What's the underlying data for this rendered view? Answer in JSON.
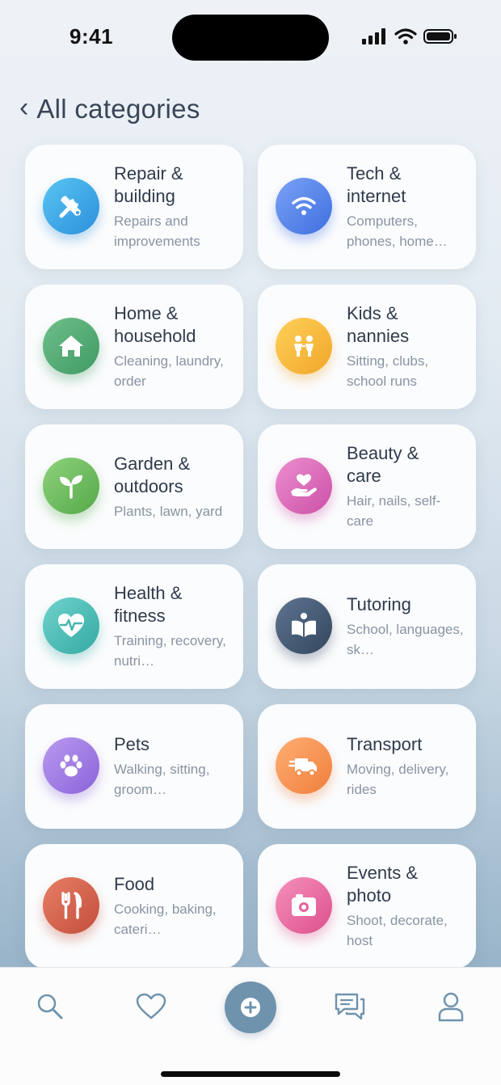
{
  "status_bar": {
    "time": "9:41"
  },
  "header": {
    "back_glyph": "‹",
    "title": "All categories"
  },
  "categories": [
    {
      "title": "Repair &\nbuilding",
      "subtitle": "Repairs and improvements",
      "icon": "tools-icon",
      "color_from": "#58c6f2",
      "color_to": "#2c8fdc"
    },
    {
      "title": "Tech &\ninternet",
      "subtitle": "Computers, phones, home…",
      "icon": "wifi-icon",
      "color_from": "#7aa2f5",
      "color_to": "#3f6fe0"
    },
    {
      "title": "Home &\nhousehold",
      "subtitle": "Cleaning, laundry, order",
      "icon": "house-icon",
      "color_from": "#6fbf8a",
      "color_to": "#3f9a63"
    },
    {
      "title": "Kids &\nnannies",
      "subtitle": "Sitting, clubs, school runs",
      "icon": "kids-icon",
      "color_from": "#ffd15a",
      "color_to": "#f0a629"
    },
    {
      "title": "Garden &\noutdoors",
      "subtitle": "Plants, lawn, yard",
      "icon": "sprout-icon",
      "color_from": "#8fd27a",
      "color_to": "#55a94a"
    },
    {
      "title": "Beauty &\ncare",
      "subtitle": "Hair, nails, self-care",
      "icon": "heart-hand-icon",
      "color_from": "#ec8fd0",
      "color_to": "#cc4fa6"
    },
    {
      "title": "Health &\nfitness",
      "subtitle": "Training, recovery, nutri…",
      "icon": "heartbeat-icon",
      "color_from": "#6fd3cc",
      "color_to": "#35a9a3"
    },
    {
      "title": "Tutoring",
      "subtitle": "School, languages, sk…",
      "icon": "book-icon",
      "color_from": "#5e7590",
      "color_to": "#33465e"
    },
    {
      "title": "Pets",
      "subtitle": "Walking, sitting, groom…",
      "icon": "paw-icon",
      "color_from": "#b99af0",
      "color_to": "#8a63d8"
    },
    {
      "title": "Transport",
      "subtitle": "Moving, delivery, rides",
      "icon": "truck-icon",
      "color_from": "#ffae73",
      "color_to": "#ef7f3c"
    },
    {
      "title": "Food",
      "subtitle": "Cooking, baking, cateri…",
      "icon": "cutlery-icon",
      "color_from": "#e77e66",
      "color_to": "#c24e3b"
    },
    {
      "title": "Events &\nphoto",
      "subtitle": "Shoot, decorate, host",
      "icon": "camera-icon",
      "color_from": "#f591bc",
      "color_to": "#dc4f8c"
    }
  ],
  "tab_bar": {
    "tabs": [
      {
        "icon": "search-icon"
      },
      {
        "icon": "heart-icon"
      },
      {
        "icon": "plus-icon"
      },
      {
        "icon": "chat-icon"
      },
      {
        "icon": "profile-icon"
      }
    ],
    "accent": "#6f93ad"
  }
}
